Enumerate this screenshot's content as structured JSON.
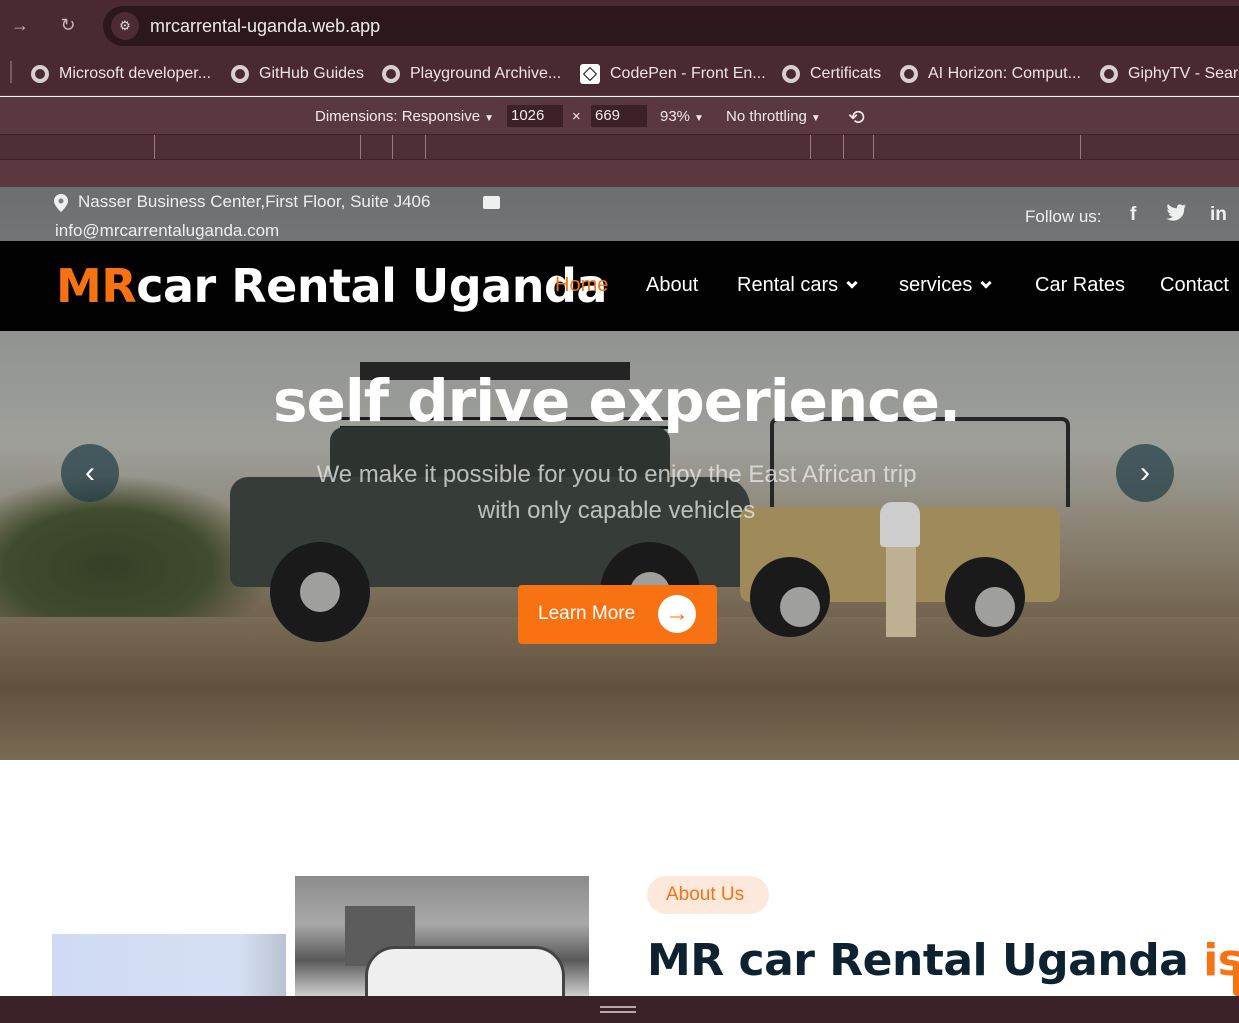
{
  "browser": {
    "url": "mrcarrental-uganda.web.app",
    "bookmarks": [
      "Microsoft developer...",
      "GitHub Guides",
      "Playground Archive...",
      "CodePen - Front En...",
      "Certificats",
      "AI Horizon: Comput...",
      "GiphyTV - Searc"
    ],
    "devtools": {
      "dimensions_label": "Dimensions: Responsive",
      "width": "1026",
      "times": "×",
      "height": "669",
      "zoom": "93%",
      "throttle": "No throttling"
    }
  },
  "site": {
    "topbar": {
      "address": "Nasser Business Center,First Floor, Suite J406",
      "email": "info@mrcarrentaluganda.com",
      "follow": "Follow us:",
      "socials": [
        "facebook-icon",
        "twitter-icon",
        "linkedin-icon"
      ]
    },
    "logo": {
      "prefix": "MR",
      "rest": "car Rental Uganda"
    },
    "nav": {
      "home": "Home",
      "about": "About",
      "rental_cars": "Rental cars",
      "services": "services",
      "car_rates": "Car Rates",
      "contact": "Contact"
    },
    "hero": {
      "title": "self drive experience.",
      "subtitle_line1": "We make it possible for you to enjoy the East African trip",
      "subtitle_line2": "with only capable vehicles",
      "cta": "Learn More"
    },
    "about": {
      "badge": "About Us",
      "heading": "MR car Rental Uganda ",
      "heading_accent": "is"
    }
  },
  "colors": {
    "accent": "#f87214",
    "navbar": "#020202",
    "heading": "#0c2230",
    "chrome": "#4a2a31"
  }
}
